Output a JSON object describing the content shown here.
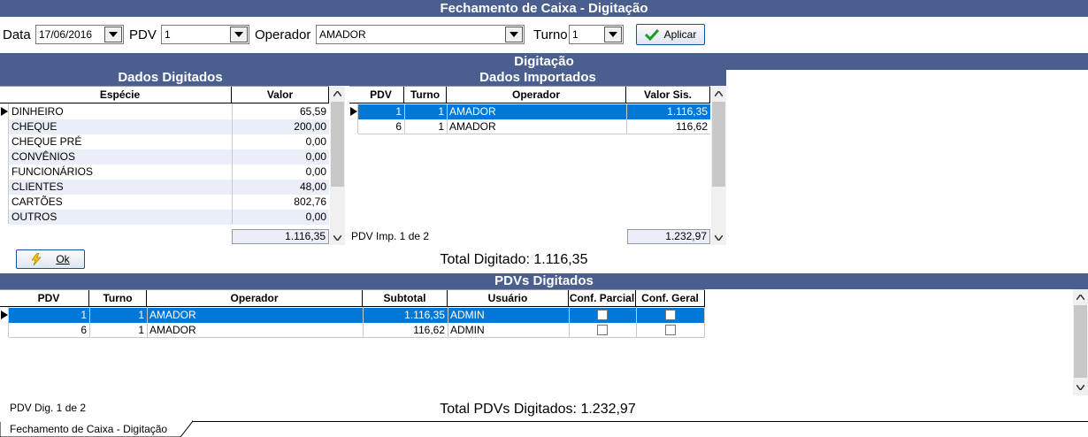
{
  "window": {
    "title": "Fechamento de Caixa - Digitação"
  },
  "toolbar": {
    "data_label": "Data",
    "data_value": "17/06/2016",
    "pdv_label": "PDV",
    "pdv_value": "1",
    "operador_label": "Operador",
    "operador_value": "AMADOR",
    "turno_label": "Turno",
    "turno_value": "1",
    "apply_label": "Aplicar"
  },
  "digitacao": {
    "title": "Digitação",
    "left_title": "Dados Digitados",
    "right_title": "Dados Importados",
    "left_columns": [
      "Espécie",
      "Valor"
    ],
    "left_rows": [
      [
        "DINHEIRO",
        "65,59"
      ],
      [
        "CHEQUE",
        "200,00"
      ],
      [
        "CHEQUE PRÉ",
        "0,00"
      ],
      [
        "CONVÊNIOS",
        "0,00"
      ],
      [
        "FUNCIONÁRIOS",
        "0,00"
      ],
      [
        "CLIENTES",
        "48,00"
      ],
      [
        "CARTÕES",
        "802,76"
      ],
      [
        "OUTROS",
        "0,00"
      ]
    ],
    "left_total": "1.116,35",
    "right_columns": [
      "PDV",
      "Turno",
      "Operador",
      "Valor Sis."
    ],
    "right_rows": [
      [
        "1",
        "1",
        "AMADOR",
        "1.116,35"
      ],
      [
        "6",
        "1",
        "AMADOR",
        "116,62"
      ]
    ],
    "right_status": "PDV Imp. 1 de 2",
    "right_total": "1.232,97",
    "ok_label": "Ok",
    "total_text": "Total Digitado: 1.116,35"
  },
  "pdvs": {
    "title": "PDVs Digitados",
    "columns": [
      "PDV",
      "Turno",
      "Operador",
      "Subtotal",
      "Usuário",
      "Conf. Parcial",
      "Conf. Geral"
    ],
    "rows": [
      [
        "1",
        "1",
        "AMADOR",
        "1.116,35",
        "ADMIN"
      ],
      [
        "6",
        "1",
        "AMADOR",
        "116,62",
        "ADMIN"
      ]
    ],
    "status": "PDV Dig. 1 de 2",
    "total_text": "Total PDVs Digitados: 1.232,97"
  },
  "tabs": [
    {
      "label": "Fechamento de Caixa - Digitação"
    }
  ]
}
